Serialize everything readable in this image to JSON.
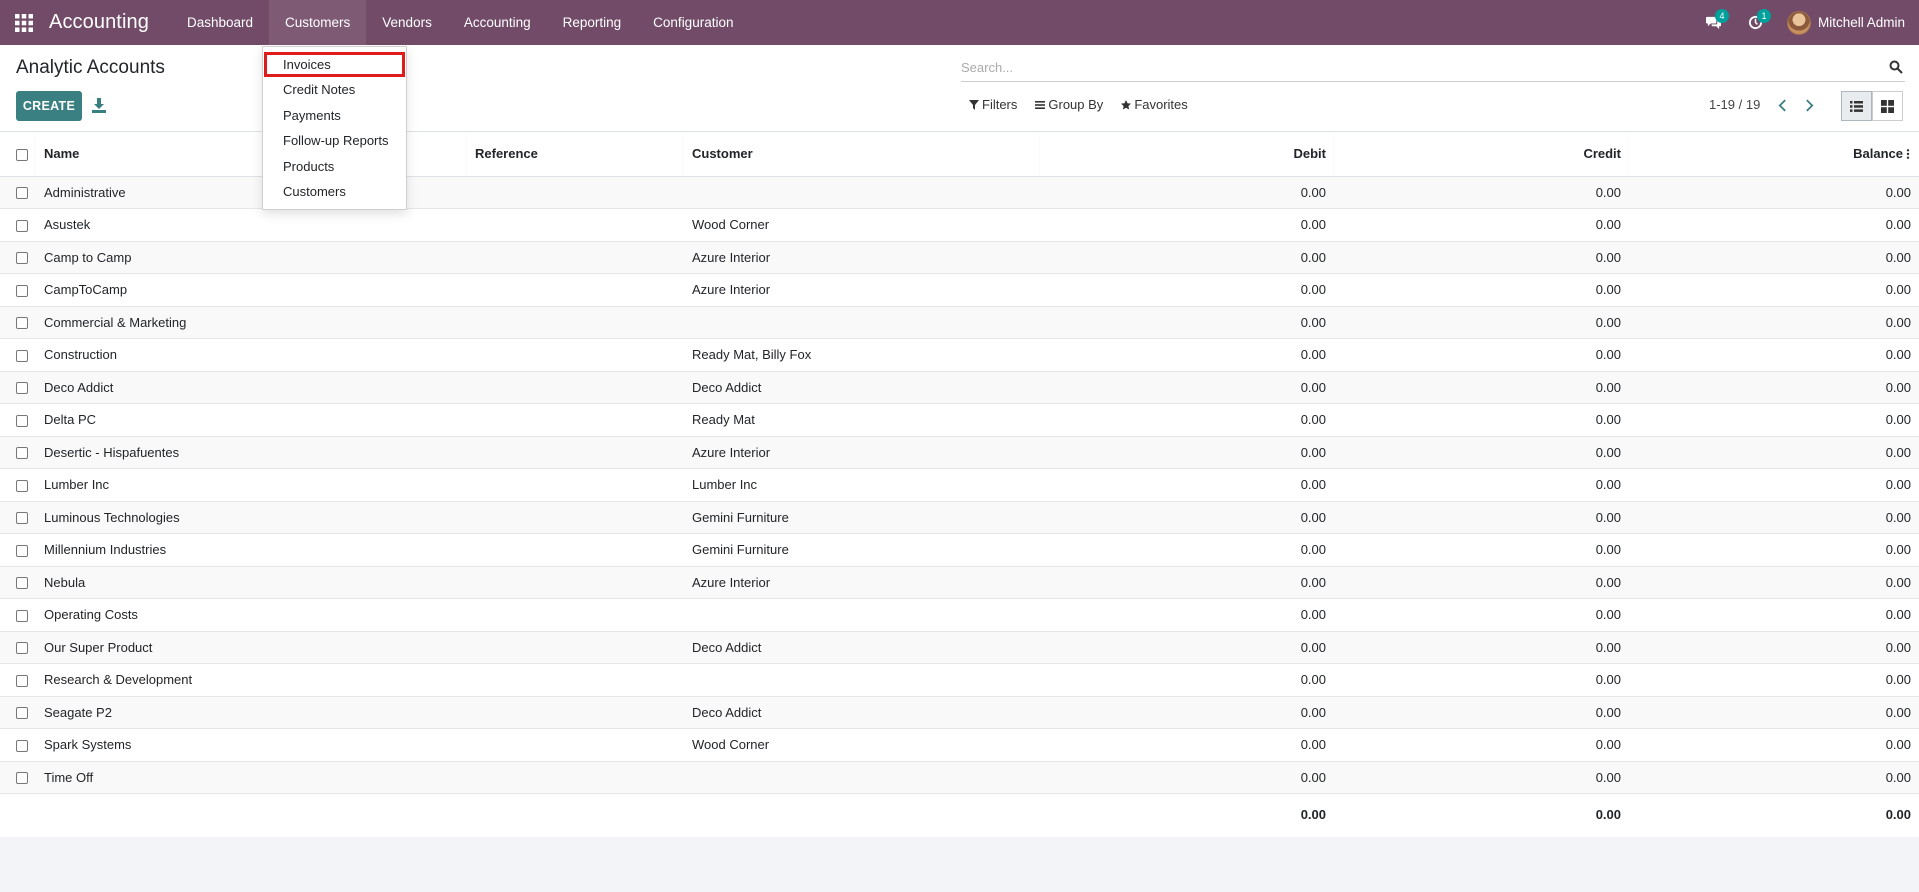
{
  "navbar": {
    "brand": "Accounting",
    "menu": [
      "Dashboard",
      "Customers",
      "Vendors",
      "Accounting",
      "Reporting",
      "Configuration"
    ],
    "messages_badge": "4",
    "activities_badge": "1",
    "user_name": "Mitchell Admin",
    "accent_color": "#714b67"
  },
  "control_panel": {
    "title": "Analytic Accounts",
    "create_label": "CREATE",
    "search_placeholder": "Search...",
    "filters_label": "Filters",
    "group_by_label": "Group By",
    "favorites_label": "Favorites",
    "pager": "1-19 / 19"
  },
  "dropdown": {
    "items": [
      "Invoices",
      "Credit Notes",
      "Payments",
      "Follow-up Reports",
      "Products",
      "Customers"
    ],
    "highlighted": "Invoices"
  },
  "table": {
    "columns": {
      "name": "Name",
      "reference": "Reference",
      "customer": "Customer",
      "debit": "Debit",
      "credit": "Credit",
      "balance": "Balance"
    },
    "rows": [
      {
        "name": "Administrative",
        "reference": "",
        "customer": "",
        "debit": "0.00",
        "credit": "0.00",
        "balance": "0.00"
      },
      {
        "name": "Asustek",
        "reference": "",
        "customer": "Wood Corner",
        "debit": "0.00",
        "credit": "0.00",
        "balance": "0.00"
      },
      {
        "name": "Camp to Camp",
        "reference": "",
        "customer": "Azure Interior",
        "debit": "0.00",
        "credit": "0.00",
        "balance": "0.00"
      },
      {
        "name": "CampToCamp",
        "reference": "",
        "customer": "Azure Interior",
        "debit": "0.00",
        "credit": "0.00",
        "balance": "0.00"
      },
      {
        "name": "Commercial & Marketing",
        "reference": "",
        "customer": "",
        "debit": "0.00",
        "credit": "0.00",
        "balance": "0.00"
      },
      {
        "name": "Construction",
        "reference": "",
        "customer": "Ready Mat, Billy Fox",
        "debit": "0.00",
        "credit": "0.00",
        "balance": "0.00"
      },
      {
        "name": "Deco Addict",
        "reference": "",
        "customer": "Deco Addict",
        "debit": "0.00",
        "credit": "0.00",
        "balance": "0.00"
      },
      {
        "name": "Delta PC",
        "reference": "",
        "customer": "Ready Mat",
        "debit": "0.00",
        "credit": "0.00",
        "balance": "0.00"
      },
      {
        "name": "Desertic - Hispafuentes",
        "reference": "",
        "customer": "Azure Interior",
        "debit": "0.00",
        "credit": "0.00",
        "balance": "0.00"
      },
      {
        "name": "Lumber Inc",
        "reference": "",
        "customer": "Lumber Inc",
        "debit": "0.00",
        "credit": "0.00",
        "balance": "0.00"
      },
      {
        "name": "Luminous Technologies",
        "reference": "",
        "customer": "Gemini Furniture",
        "debit": "0.00",
        "credit": "0.00",
        "balance": "0.00"
      },
      {
        "name": "Millennium Industries",
        "reference": "",
        "customer": "Gemini Furniture",
        "debit": "0.00",
        "credit": "0.00",
        "balance": "0.00"
      },
      {
        "name": "Nebula",
        "reference": "",
        "customer": "Azure Interior",
        "debit": "0.00",
        "credit": "0.00",
        "balance": "0.00"
      },
      {
        "name": "Operating Costs",
        "reference": "",
        "customer": "",
        "debit": "0.00",
        "credit": "0.00",
        "balance": "0.00"
      },
      {
        "name": "Our Super Product",
        "reference": "",
        "customer": "Deco Addict",
        "debit": "0.00",
        "credit": "0.00",
        "balance": "0.00"
      },
      {
        "name": "Research & Development",
        "reference": "",
        "customer": "",
        "debit": "0.00",
        "credit": "0.00",
        "balance": "0.00"
      },
      {
        "name": "Seagate P2",
        "reference": "",
        "customer": "Deco Addict",
        "debit": "0.00",
        "credit": "0.00",
        "balance": "0.00"
      },
      {
        "name": "Spark Systems",
        "reference": "",
        "customer": "Wood Corner",
        "debit": "0.00",
        "credit": "0.00",
        "balance": "0.00"
      },
      {
        "name": "Time Off",
        "reference": "",
        "customer": "",
        "debit": "0.00",
        "credit": "0.00",
        "balance": "0.00"
      }
    ],
    "totals": {
      "debit": "0.00",
      "credit": "0.00",
      "balance": "0.00"
    }
  }
}
